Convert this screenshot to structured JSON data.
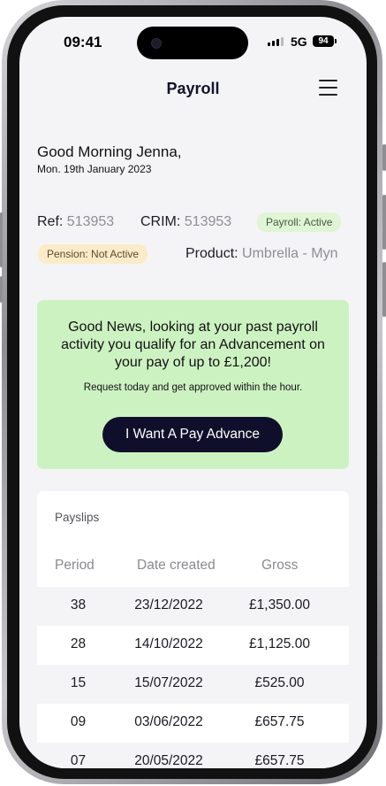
{
  "status_bar": {
    "time": "09:41",
    "network": "5G",
    "battery": "94"
  },
  "header": {
    "title": "Payroll"
  },
  "greeting": {
    "text": "Good Morning Jenna,",
    "date": "Mon. 19th January 2023"
  },
  "info": {
    "ref_label": "Ref:",
    "ref_value": "513953",
    "crim_label": "CRIM:",
    "crim_value": "513953",
    "payroll_status": "Payroll: Active",
    "pension_status": "Pension: Not Active",
    "product_label": "Product:",
    "product_value": "Umbrella - Myn"
  },
  "promo": {
    "headline": "Good News, looking at your past payroll activity you qualify for an Advancement on your pay of up to £1,200!",
    "subtext": "Request today and get approved within the hour.",
    "button": "I Want A Pay Advance"
  },
  "payslips": {
    "title": "Payslips",
    "columns": [
      "Period",
      "Date created",
      "Gross"
    ],
    "rows": [
      [
        "38",
        "23/12/2022",
        "£1,350.00"
      ],
      [
        "28",
        "14/10/2022",
        "£1,125.00"
      ],
      [
        "15",
        "15/07/2022",
        "£525.00"
      ],
      [
        "09",
        "03/06/2022",
        "£657.75"
      ],
      [
        "07",
        "20/05/2022",
        "£657.75"
      ]
    ]
  },
  "colors": {
    "promo_bg": "#cdf2c2",
    "button_bg": "#100f2b",
    "payroll_pill": "#dff5d6",
    "pension_pill": "#fcebc8"
  }
}
